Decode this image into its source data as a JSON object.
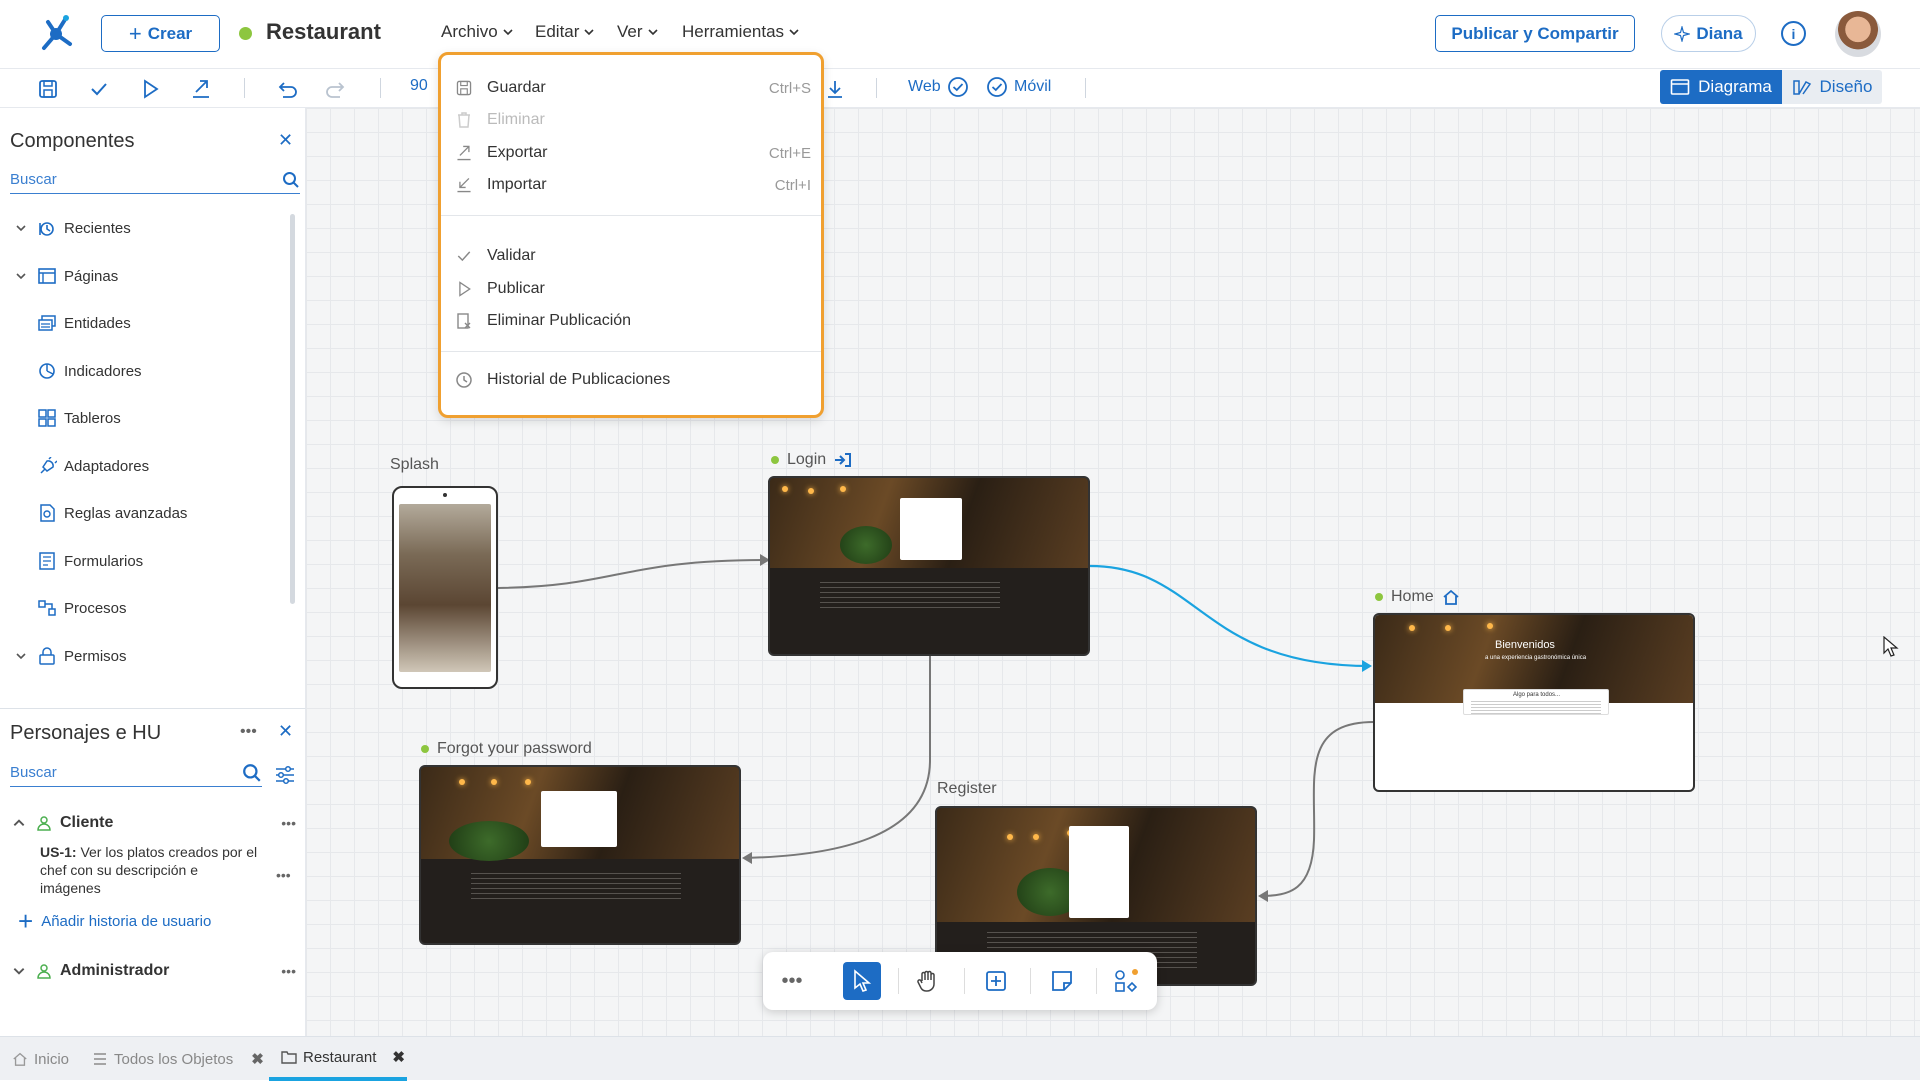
{
  "header": {
    "create_label": "Crear",
    "app_name": "Restaurant",
    "menus": [
      "Archivo",
      "Editar",
      "Ver",
      "Herramientas"
    ],
    "publish_label": "Publicar y Compartir",
    "assistant_label": "Diana"
  },
  "toolbar": {
    "zoom": "90",
    "web_label": "Web",
    "mobile_label": "Móvil",
    "view_diagram": "Diagrama",
    "view_design": "Diseño"
  },
  "components_panel": {
    "title": "Componentes",
    "search_placeholder": "Buscar",
    "items": [
      {
        "label": "Recientes",
        "expanded": true,
        "icon": "recent-icon"
      },
      {
        "label": "Páginas",
        "expanded": true,
        "icon": "pages-icon"
      },
      {
        "label": "Entidades",
        "icon": "entities-icon"
      },
      {
        "label": "Indicadores",
        "icon": "indicators-icon"
      },
      {
        "label": "Tableros",
        "icon": "dashboards-icon"
      },
      {
        "label": "Adaptadores",
        "icon": "adapters-icon"
      },
      {
        "label": "Reglas avanzadas",
        "icon": "rules-icon"
      },
      {
        "label": "Formularios",
        "icon": "forms-icon"
      },
      {
        "label": "Procesos",
        "icon": "processes-icon"
      },
      {
        "label": "Permisos",
        "expanded": true,
        "icon": "permissions-icon"
      }
    ]
  },
  "personas_panel": {
    "title": "Personajes e HU",
    "search_placeholder": "Buscar",
    "personas": [
      {
        "name": "Cliente",
        "expanded": true
      },
      {
        "name": "Administrador",
        "expanded": true
      }
    ],
    "story_id": "US-1:",
    "story_text_1": "Ver los platos creados por el",
    "story_text_2": "chef con su descripción e",
    "story_text_3": "imágenes",
    "add_story_label": "Añadir historia de usuario"
  },
  "file_menu": {
    "items": [
      {
        "label": "Guardar",
        "shortcut": "Ctrl+S",
        "enabled": true
      },
      {
        "label": "Eliminar",
        "shortcut": "",
        "enabled": false
      },
      {
        "label": "Exportar",
        "shortcut": "Ctrl+E",
        "enabled": true
      },
      {
        "label": "Importar",
        "shortcut": "Ctrl+I",
        "enabled": true
      },
      {
        "label": "Validar",
        "shortcut": "",
        "enabled": true
      },
      {
        "label": "Publicar",
        "shortcut": "",
        "enabled": true
      },
      {
        "label": "Eliminar Publicación",
        "shortcut": "",
        "enabled": true
      },
      {
        "label": "Historial de Publicaciones",
        "shortcut": "",
        "enabled": true
      }
    ]
  },
  "diagram": {
    "nodes": {
      "splash": "Splash",
      "login": "Login",
      "home": "Home",
      "forgot": "Forgot your password",
      "register": "Register"
    },
    "home_hero_title": "Bienvenidos",
    "home_hero_sub": "a una experiencia gastronómica única",
    "home_section": "Algo para todos..."
  },
  "bottom_tabs": [
    {
      "label": "Inicio",
      "active": false
    },
    {
      "label": "Todos los Objetos",
      "active": false
    },
    {
      "label": "Restaurant",
      "active": true
    }
  ],
  "colors": {
    "primary": "#1d6cc4",
    "menu_highlight": "#f0a030",
    "status_green": "#8dc63f",
    "connector_blue": "#1aa3e0"
  }
}
